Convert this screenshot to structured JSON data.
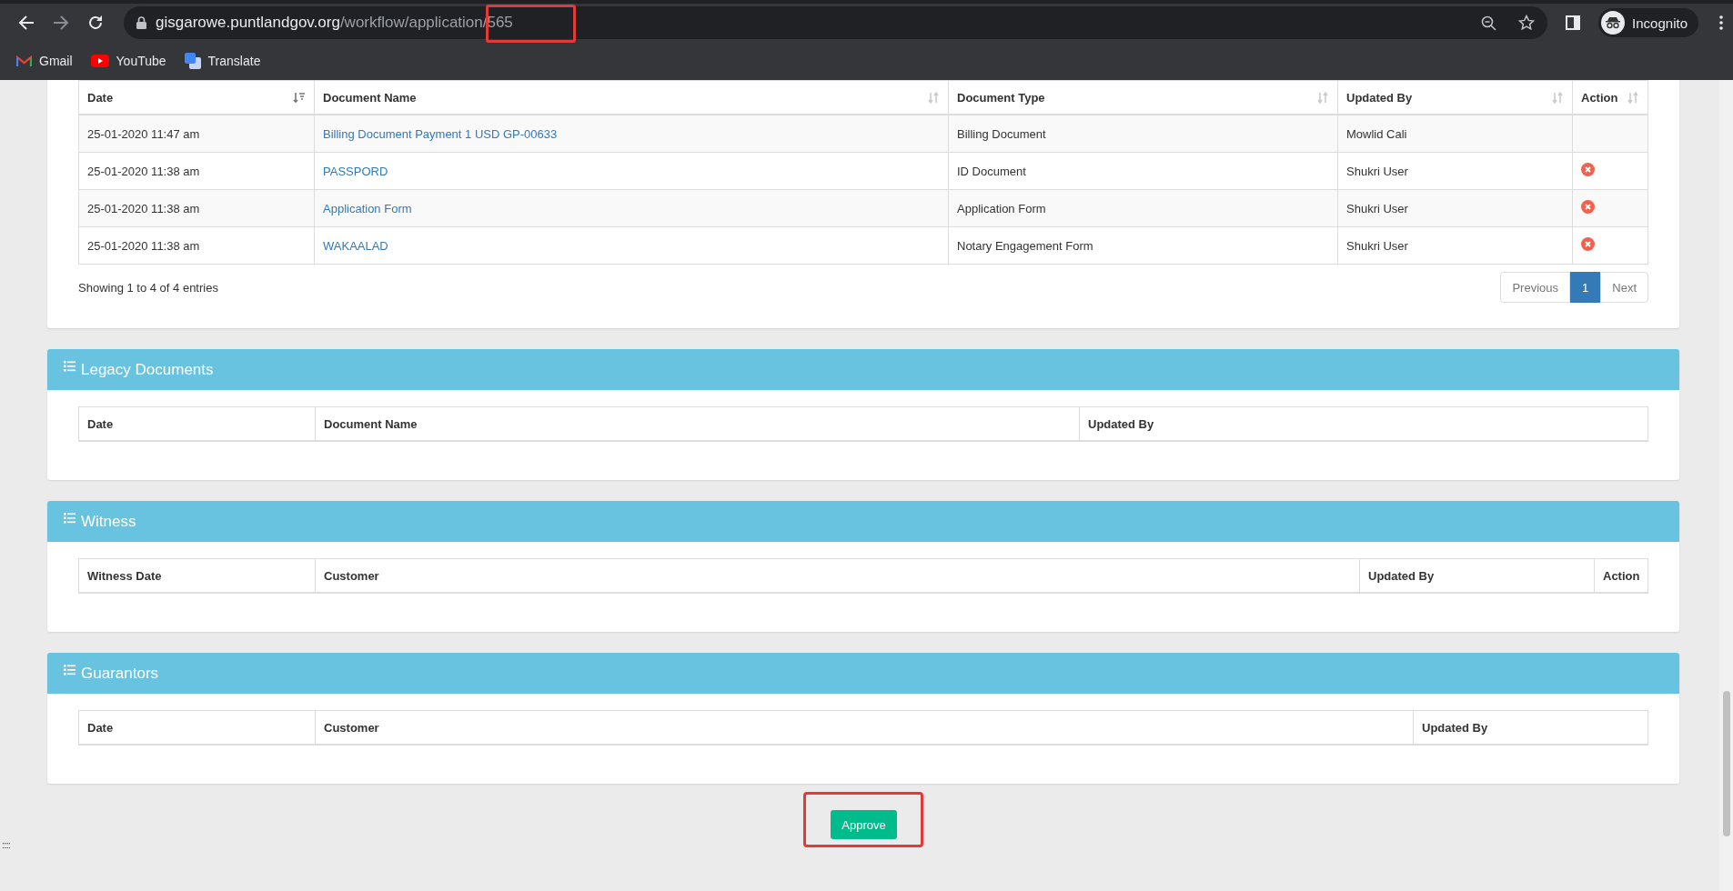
{
  "browser": {
    "url_domain": "gisgarowe.puntlandgov.org",
    "url_path": "/workflow/application/565",
    "profile_label": "Incognito",
    "bookmarks": [
      {
        "label": "Gmail",
        "kind": "gmail"
      },
      {
        "label": "YouTube",
        "kind": "youtube"
      },
      {
        "label": "Translate",
        "kind": "translate"
      }
    ]
  },
  "documents": {
    "columns": [
      {
        "label": "Date",
        "sorted": true
      },
      {
        "label": "Document Name",
        "sorted": false
      },
      {
        "label": "Document Type",
        "sorted": false
      },
      {
        "label": "Updated By",
        "sorted": false
      },
      {
        "label": "Action",
        "sorted": false
      }
    ],
    "rows": [
      {
        "date": "25-01-2020 11:47 am",
        "document_name": "Billing Document Payment 1 USD GP-00633",
        "document_type": "Billing Document",
        "updated_by": "Mowlid Cali",
        "removable": false
      },
      {
        "date": "25-01-2020 11:38 am",
        "document_name": "PASSPORD",
        "document_type": "ID Document",
        "updated_by": "Shukri User",
        "removable": true
      },
      {
        "date": "25-01-2020 11:38 am",
        "document_name": "Application Form",
        "document_type": "Application Form",
        "updated_by": "Shukri User",
        "removable": true
      },
      {
        "date": "25-01-2020 11:38 am",
        "document_name": "WAKAALAD",
        "document_type": "Notary Engagement Form",
        "updated_by": "Shukri User",
        "removable": true
      }
    ],
    "info": "Showing 1 to 4 of 4 entries",
    "pagination": {
      "previous": "Previous",
      "next": "Next",
      "pages": [
        {
          "label": "1",
          "selected": true
        }
      ]
    }
  },
  "sections": [
    {
      "title": "Legacy Documents",
      "columns": [
        "Date",
        "Document Name",
        "Updated By"
      ]
    },
    {
      "title": "Witness",
      "columns": [
        "Witness Date",
        "Customer",
        "Updated By",
        "Action"
      ]
    },
    {
      "title": "Guarantors",
      "columns": [
        "Date",
        "Customer",
        "Updated By"
      ]
    }
  ],
  "approve_button": "Approve",
  "corner_handle": ":::::"
}
